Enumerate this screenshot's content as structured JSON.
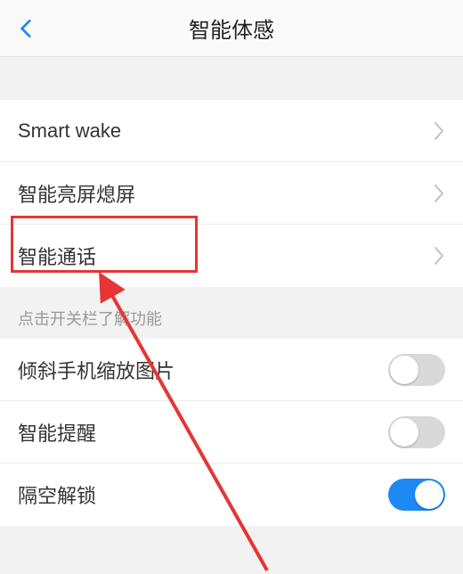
{
  "header": {
    "title": "智能体感"
  },
  "group1": {
    "items": [
      {
        "label": "Smart wake"
      },
      {
        "label": "智能亮屏熄屏"
      },
      {
        "label": "智能通话"
      }
    ]
  },
  "hint": "点击开关栏了解功能",
  "group2": {
    "items": [
      {
        "label": "倾斜手机缩放图片",
        "on": false
      },
      {
        "label": "智能提醒",
        "on": false
      },
      {
        "label": "隔空解锁",
        "on": true
      }
    ]
  }
}
